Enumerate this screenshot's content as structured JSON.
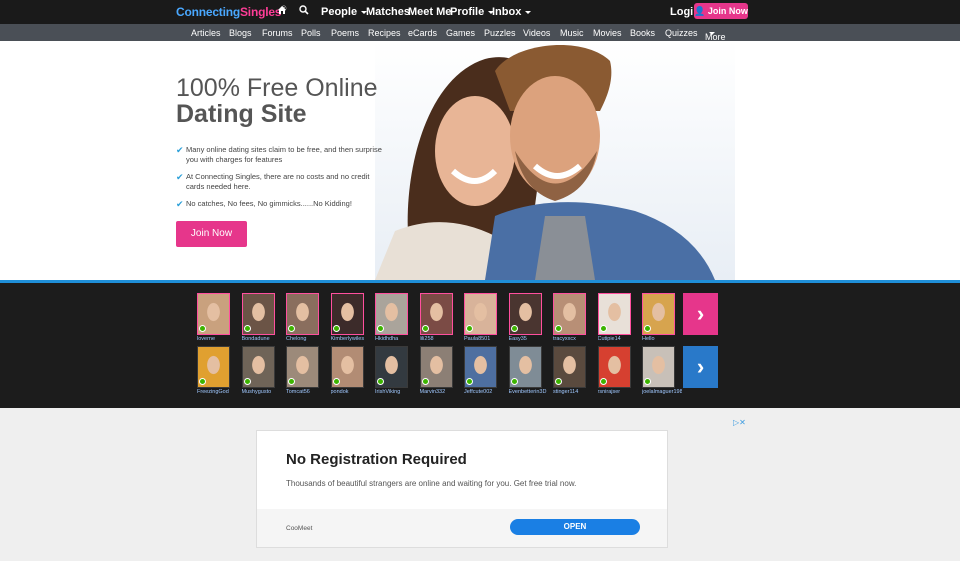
{
  "brand": {
    "part1": "Connecting",
    "part2": "Singles",
    "mark": "®"
  },
  "topnav": {
    "people": "People",
    "matches": "Matches",
    "meet_me": "Meet Me",
    "profile": "Profile",
    "inbox": "Inbox",
    "login": "Login",
    "join": "Join Now"
  },
  "subnav": [
    "Articles",
    "Blogs",
    "Forums",
    "Polls",
    "Poems",
    "Recipes",
    "eCards",
    "Games",
    "Puzzles",
    "Videos",
    "Music",
    "Movies",
    "Books",
    "Quizzes",
    "More"
  ],
  "hero": {
    "title_line1": "100% Free Online",
    "title_line2": "Dating Site",
    "bullets": [
      "Many online dating sites claim to be free, and then surprise you with charges for features",
      "At Connecting Singles, there are no costs and no credit cards needed here.",
      "No catches, No fees, No gimmicks......No Kidding!"
    ],
    "join_button": "Join Now"
  },
  "members_row1": [
    "loverne",
    "Bondadune",
    "Chelong",
    "Kimberlywiles",
    "Hkidhdha",
    "lili258",
    "Paula8501",
    "Easy35",
    "tracyxxcx",
    "Cutipie14",
    "Hello"
  ],
  "members_row2": [
    "FreezingGod",
    "Mushygusto",
    "Tomcat56",
    "pondok",
    "IrishViking",
    "Marvin332",
    "Jeffcute002",
    "Evenbetterin3D",
    "stinger114",
    "rsnirajser",
    "joelalmaguer1984"
  ],
  "colors": {
    "accent_pink": "#e6368b",
    "accent_blue": "#1f8fd8",
    "open_blue": "#1a7fe4"
  },
  "ad": {
    "title": "No Registration Required",
    "body": "Thousands of beautiful strangers are online and waiting for you. Get free trial now.",
    "advertiser": "CooMeet",
    "cta": "OPEN"
  }
}
